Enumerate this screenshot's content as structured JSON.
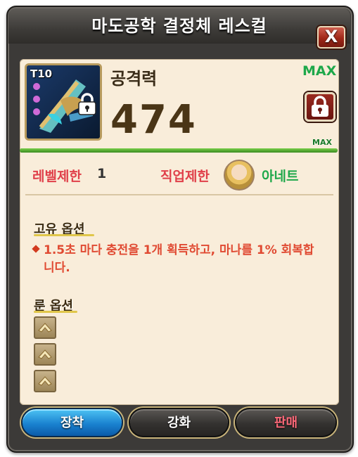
{
  "window": {
    "title": "마도공학 결정체 레스컬",
    "close_label": "X"
  },
  "item": {
    "tier": "T10",
    "stat_name": "공격력",
    "stat_value": "474",
    "max_label": "MAX",
    "bar_max_label": "MAX",
    "upgrade_progress": 1.0
  },
  "requirements": {
    "level_label": "레벨제한",
    "level_value": "1",
    "job_label": "직업제한",
    "job_value": "아네트"
  },
  "unique_option": {
    "title": "고유 옵션",
    "text": "1.5초 마다 충전을 1개 획득하고, 마나를 1% 회복합니다."
  },
  "rune_option": {
    "title": "룬 옵션",
    "slot_count": 3
  },
  "buttons": {
    "equip": "장착",
    "upgrade": "강화",
    "sell": "판매"
  },
  "colors": {
    "max_green": "#1ea84a",
    "requirement_red": "#e0404a",
    "option_red": "#e04a32",
    "equip_blue": "#1a82d0",
    "sell_pink": "#ff6a7a"
  }
}
